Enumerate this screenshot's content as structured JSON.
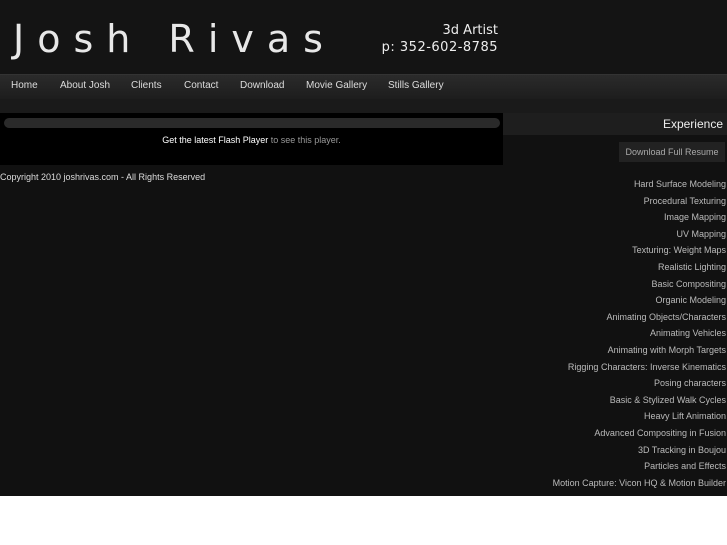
{
  "header": {
    "logo": "Josh Rivas",
    "role": "3d Artist",
    "phone": "p: 352-602-8785"
  },
  "nav": {
    "items": [
      {
        "label": "Home"
      },
      {
        "label": "About Josh"
      },
      {
        "label": "Clients"
      },
      {
        "label": "Contact"
      },
      {
        "label": "Download"
      },
      {
        "label": "Movie Gallery"
      },
      {
        "label": "Stills Gallery"
      }
    ]
  },
  "flash": {
    "link_text": "Get the latest Flash Player",
    "rest_text": " to see this player."
  },
  "footer": {
    "copyright": "Copyright 2010 joshrivas.com - All Rights Reserved"
  },
  "experience": {
    "title": "Experience",
    "resume_button": "Download Full Resume",
    "skills": [
      "Hard Surface Modeling",
      "Procedural Texturing",
      "Image Mapping",
      "UV Mapping",
      "Texturing: Weight Maps",
      "Realistic Lighting",
      "Basic Compositing",
      "Organic Modeling",
      "Animating Objects/Characters",
      "Animating Vehicles",
      "Animating with Morph Targets",
      "Rigging Characters: Inverse Kinematics",
      "Posing characters",
      "Basic & Stylized Walk Cycles",
      "Heavy Lift Animation",
      "Advanced Compositing in Fusion",
      "3D Tracking in Boujou",
      "Particles and Effects",
      "Motion Capture: Vicon HQ & Motion Builder"
    ]
  }
}
